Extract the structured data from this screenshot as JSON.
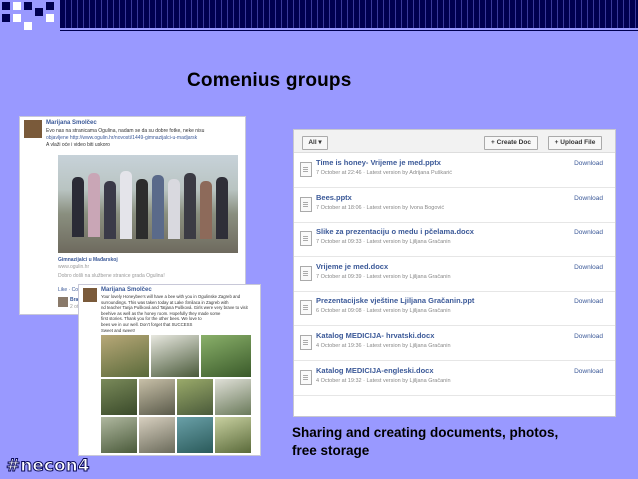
{
  "slide": {
    "title": "Comenius groups",
    "caption_line1": "Sharing and creating documents, photos,",
    "caption_line2": "free storage",
    "logo_text": "#necon4",
    "colors": {
      "background": "#9999ff",
      "band": "#000050"
    }
  },
  "post1": {
    "author": "Marijana Smolčec",
    "text_line1": "Evo nas na stranicama Ogulina, nadam se da su dobre fotke, neke nisu",
    "text_line2": "objavljene http://www.ogulin.hr/novosti/1449-gimnazijalci-u-madjarsk",
    "text_line3": "A vlaži oće i video biti uskoro",
    "link_title": "Gimnazijalci u Mađarskoj",
    "link_url": "www.ogulin.hr",
    "link_desc": "Dobro došli na službene stranice grada Ogulina!",
    "actions": "Like · Co",
    "footer_name": "Brank",
    "footer_sub": "2 othe"
  },
  "post2": {
    "author": "Marijana Smolčec",
    "text_line1": "Your lovely Honeybee's will have a bee with you in Ogulinske Zagreb and",
    "text_line2": "surroundings. This was taken today at Lake Šmilaca in Zagreb with",
    "text_line3": "nd teacher Tanja Pušková and Tatjana Pušková. Girls were very brave to visit",
    "text_line4": "beehive as well as the honey room. Hopefully they made some",
    "text_line5": "first stories. Thank you for the other bees. We love to",
    "text_line6": "bees we in our well. Don't forget that SUCCESS",
    "text_line7": "Sweet and sweet!"
  },
  "docs": {
    "filter_label": "All ▾",
    "create_label": "+ Create Doc",
    "upload_label": "+ Upload File",
    "download_label": "Download",
    "items": [
      {
        "name": "Time is honey- Vrijeme je med.pptx",
        "meta": "7 October at 22:46 · Latest version by Adrijana Puškarić"
      },
      {
        "name": "Bees.pptx",
        "meta": "7 October at 18:06 · Latest version by Ivona Bogović"
      },
      {
        "name": "Slike za prezentaciju o medu i pčelama.docx",
        "meta": "7 October at 09:33 · Latest version by Ljiljana Gračanin"
      },
      {
        "name": "Vrijeme je med.docx",
        "meta": "7 October at 09:39 · Latest version by Ljiljana Gračanin"
      },
      {
        "name": "Prezentacijske vještine Ljiljana Gračanin.ppt",
        "meta": "6 October at 09:08 · Latest version by Ljiljana Gračanin"
      },
      {
        "name": "Katalog MEDICIJA- hrvatski.docx",
        "meta": "4 October at 19:36 · Latest version by Ljiljana Gračanin"
      },
      {
        "name": "Katalog MEDICIJA-engleski.docx",
        "meta": "4 October at 19:32 · Latest version by Ljiljana Gračanin"
      }
    ]
  }
}
